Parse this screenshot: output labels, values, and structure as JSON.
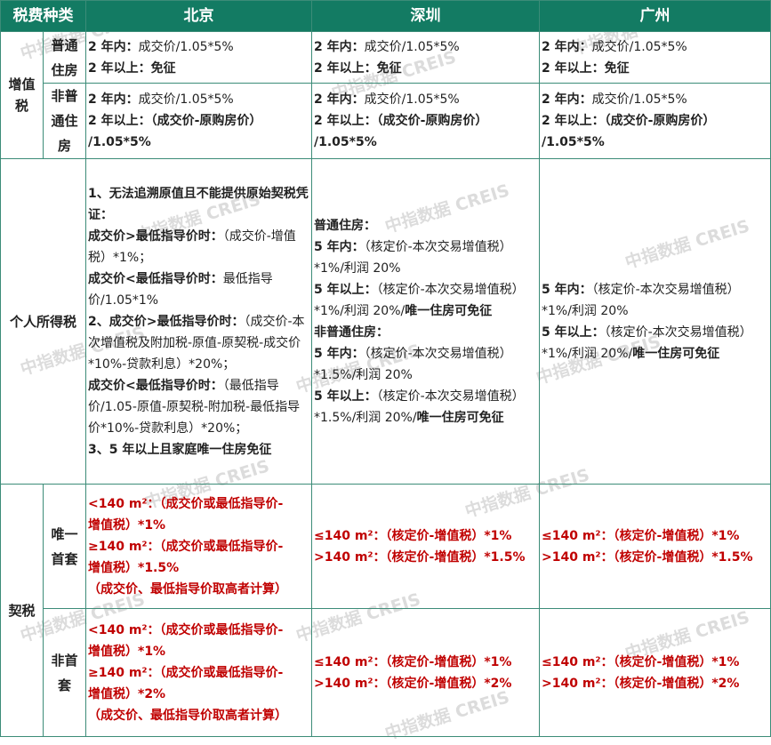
{
  "header": {
    "col_tax": "税费种类",
    "col_beijing": "北京",
    "col_shenzhen": "深圳",
    "col_guangzhou": "广州"
  },
  "vat": {
    "label": "增值税",
    "ordinary": {
      "label": "普通住房",
      "beijing": [
        "2 年内：",
        "成交价/1.05*5%",
        "2 年以上：",
        "免征"
      ],
      "shenzhen": [
        "2 年内：",
        "成交价/1.05*5%",
        "2 年以上：",
        "免征"
      ],
      "guangzhou": [
        "2 年内：",
        "成交价/1.05*5%",
        "2 年以上：",
        "免征"
      ]
    },
    "non_ordinary": {
      "label": "非普通住房",
      "beijing": [
        "2 年内：",
        "成交价/1.05*5%",
        "2 年以上：（成交价-原购房价）",
        "/1.05*5%"
      ],
      "shenzhen": [
        "2 年内：",
        "成交价/1.05*5%",
        "2 年以上：（成交价-原购房价）",
        "/1.05*5%"
      ],
      "guangzhou": [
        "2 年内：",
        "成交价/1.05*5%",
        "2 年以上：（成交价-原购房价）",
        "/1.05*5%"
      ]
    }
  },
  "pit": {
    "label": "个人所得税",
    "beijing": [
      "1、无法追溯原值且不能提供原始契税凭证：",
      "成交价>最低指导价时：",
      "（成交价-增值税）*1%；",
      "成交价<最低指导价时：",
      "最低指导价/1.05*1%",
      "2、成交价>最低指导价时：",
      "（成交价-本次增值税及附加税-原值-原契税-成交价*10%-贷款利息）*20%；",
      "成交价<最低指导价时：",
      "（最低指导价/1.05-原值-原契税-附加税-最低指导价*10%-贷款利息）*20%；",
      "3、5 年以上且家庭唯一住房免征"
    ],
    "shenzhen": [
      "普通住房：",
      "5 年内：",
      "（核定价-本次交易增值税）*1%/利润 20%",
      "5 年以上：",
      "（核定价-本次交易增值税）*1%/利润 20%/",
      "唯一住房可免征",
      "非普通住房：",
      "5 年内：",
      "（核定价-本次交易增值税）*1.5%/利润 20%",
      "5 年以上：",
      "（核定价-本次交易增值税）*1.5%/利润 20%/",
      "唯一住房可免征"
    ],
    "guangzhou": [
      "5 年内：",
      "（核定价-本次交易增值税）*1%/利润 20%",
      "5 年以上：",
      "（核定价-本次交易增值税）*1%/利润 20%/",
      "唯一住房可免征"
    ]
  },
  "deed": {
    "label": "契税",
    "first": {
      "label": "唯一首套",
      "beijing": [
        "<140 m²：（成交价或最低指导价-",
        "增值税）*1%",
        "≥140 m²：（成交价或最低指导价-",
        "增值税）*1.5%",
        "（成交价、最低指导价取高者计算）"
      ],
      "shenzhen": [
        "≤140 m²：（核定价-增值税）*1%",
        ">140 m²：（核定价-增值税）*1.5%"
      ],
      "guangzhou": [
        "≤140 m²：（核定价-增值税）*1%",
        ">140 m²：（核定价-增值税）*1.5%"
      ]
    },
    "other": {
      "label": "非首套",
      "beijing": [
        "<140 m²：（成交价或最低指导价-",
        "增值税）*1%",
        "≥140 m²：（成交价或最低指导价-",
        "增值税）*2%",
        "（成交价、最低指导价取高者计算）"
      ],
      "shenzhen": [
        "≤140 m²：（核定价-增值税）*1%",
        ">140 m²：（核定价-增值税）*2%"
      ],
      "guangzhou": [
        "≤140 m²：（核定价-增值税）*1%",
        ">140 m²：（核定价-增值税）*2%"
      ]
    }
  },
  "watermark": "中指数据 CREIS",
  "colors": {
    "header_bg": "#137b63",
    "border": "#3c8c78",
    "red_text": "#c00000"
  }
}
